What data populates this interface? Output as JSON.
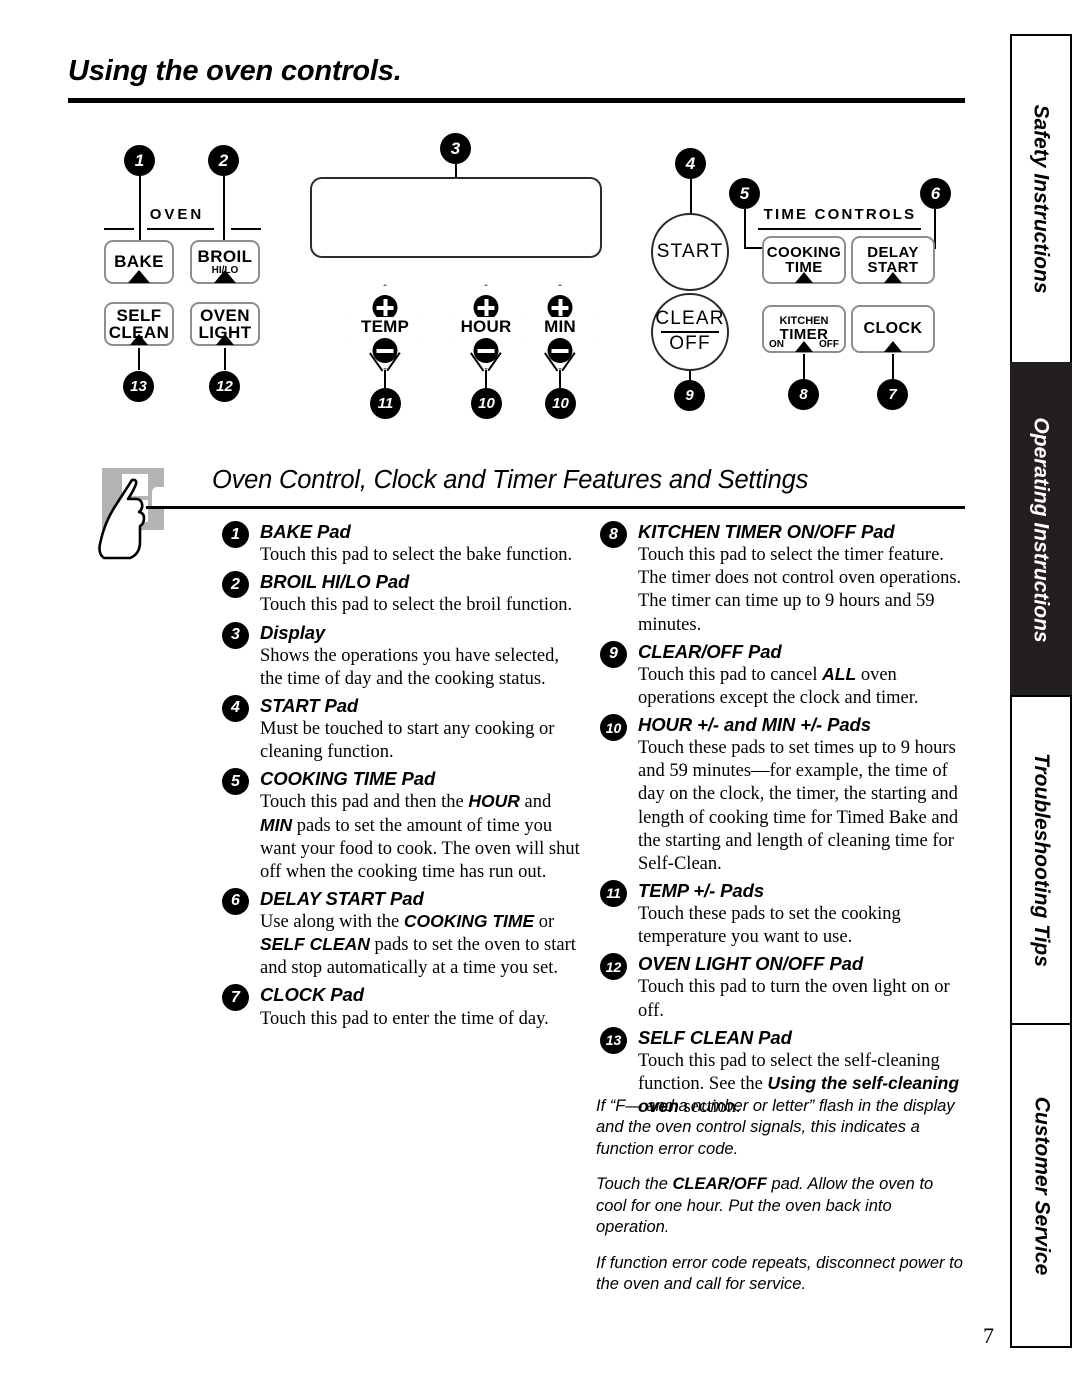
{
  "page": {
    "title": "Using the oven controls.",
    "number": "7"
  },
  "control_panel": {
    "oven_group_label": "OVEN",
    "time_controls_group_label": "TIME CONTROLS",
    "pads": {
      "bake": "BAKE",
      "broil": "BROIL",
      "broil_sub": "HI/LO",
      "self": "SELF",
      "clean": "CLEAN",
      "oven": "OVEN",
      "light": "LIGHT",
      "start": "START",
      "clear": "CLEAR",
      "off": "OFF",
      "cooking": "COOKING",
      "time": "TIME",
      "delay": "DELAY",
      "start2": "START",
      "kitchen": "KITCHEN",
      "timer": "TIMER",
      "on": "ON",
      "off2": "OFF",
      "clock": "CLOCK",
      "temp": "TEMP",
      "hour": "HOUR",
      "min": "MIN"
    },
    "callouts": {
      "c1": "1",
      "c2": "2",
      "c3": "3",
      "c4": "4",
      "c5": "5",
      "c6": "6",
      "c7": "7",
      "c8": "8",
      "c9": "9",
      "c10a": "10",
      "c10b": "10",
      "c11": "11",
      "c12": "12",
      "c13": "13"
    }
  },
  "section": {
    "heading": "Oven Control, Clock and Timer Features and Settings"
  },
  "features_left": [
    {
      "num": "1",
      "title": "BAKE Pad",
      "text": "Touch this pad to select the bake function."
    },
    {
      "num": "2",
      "title": "BROIL HI/LO Pad",
      "text": "Touch this pad to select the broil function."
    },
    {
      "num": "3",
      "title": "Display",
      "text": "Shows the operations you have selected, the time of day and the cooking status."
    },
    {
      "num": "4",
      "title": "START Pad",
      "text": "Must be touched to start any cooking or cleaning function."
    },
    {
      "num": "5",
      "title": "COOKING TIME Pad",
      "text": "Touch this pad and then the HOUR and MIN pads to set the amount of time you want your food to cook. The oven will shut off when the cooking time has run out."
    },
    {
      "num": "6",
      "title": "DELAY START Pad",
      "text": "Use along with the COOKING TIME or SELF CLEAN pads to set the oven to start and stop automatically at a time you set."
    },
    {
      "num": "7",
      "title": "CLOCK Pad",
      "text": "Touch this pad to enter the time of day."
    }
  ],
  "features_right": [
    {
      "num": "8",
      "title": "KITCHEN TIMER ON/OFF Pad",
      "text": "Touch this pad to select the timer feature. The timer does not control oven operations. The timer can time up to 9 hours and 59 minutes."
    },
    {
      "num": "9",
      "title": "CLEAR/OFF Pad",
      "text": "Touch this pad to cancel ALL oven operations except the clock and timer."
    },
    {
      "num": "10",
      "title": "HOUR +/- and MIN +/- Pads",
      "text": "Touch these pads to set times up to 9 hours and 59 minutes—for example, the time of day on the clock, the timer, the starting and length of cooking time for Timed Bake and the starting and length of cleaning time for Self-Clean."
    },
    {
      "num": "11",
      "title": "TEMP +/- Pads",
      "text": "Touch these pads to set the cooking temperature you want to use."
    },
    {
      "num": "12",
      "title": "OVEN LIGHT ON/OFF Pad",
      "text": "Touch this pad to turn the oven light on or off."
    },
    {
      "num": "13",
      "title": "SELF CLEAN Pad",
      "text": "Touch this pad to select the self-cleaning function. See the Using the self-cleaning oven section."
    }
  ],
  "notes": [
    "If “F— and a number or letter” flash in the display and the oven control signals, this indicates a function error code.",
    "Touch the CLEAR/OFF pad. Allow the oven to cool for one hour. Put the oven back into operation.",
    "If function error code repeats, disconnect power to the oven and call for service."
  ],
  "tabs": [
    {
      "label": "Safety Instructions",
      "active": false
    },
    {
      "label": "Operating Instructions",
      "active": true
    },
    {
      "label": "Troubleshooting Tips",
      "active": false
    },
    {
      "label": "Customer Service",
      "active": false
    }
  ],
  "colors": {
    "ink": "#000000",
    "active_tab_bg": "#231f20",
    "pad_border": "#8d8d8d",
    "hand_bg": "#b3b3b3"
  }
}
